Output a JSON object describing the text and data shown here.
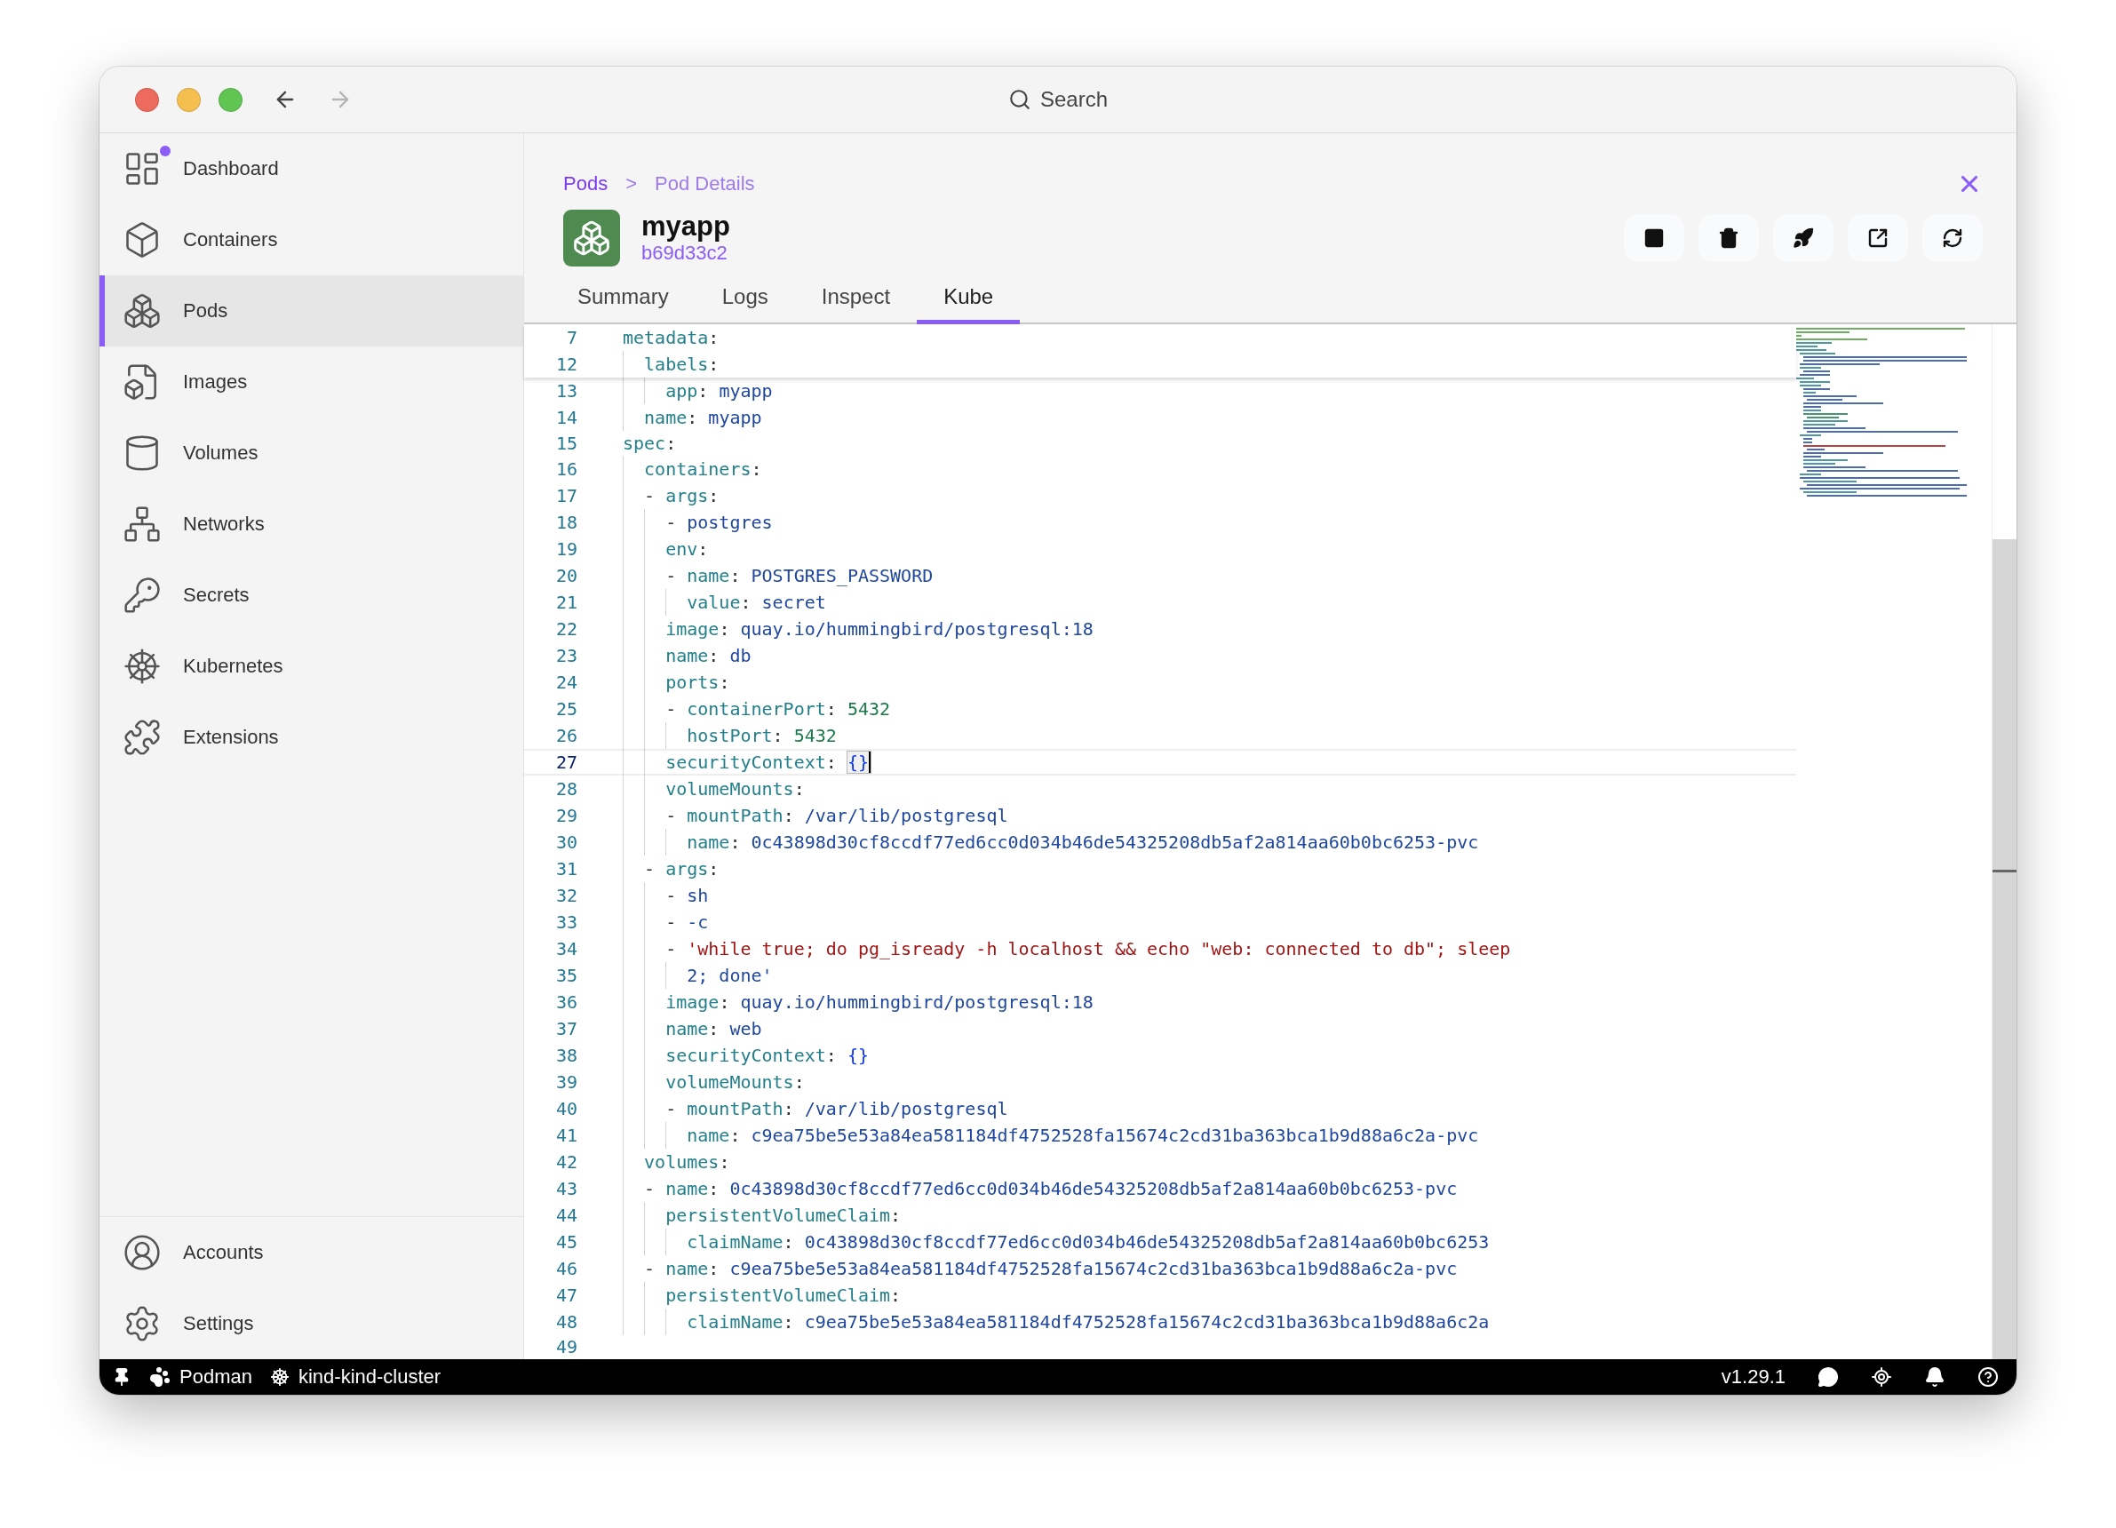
{
  "title_bar": {
    "search_label": "Search"
  },
  "sidebar": {
    "items": [
      {
        "kind": "dashboard",
        "label": "Dashboard",
        "selected": false,
        "notification": true
      },
      {
        "kind": "containers",
        "label": "Containers",
        "selected": false,
        "notification": false
      },
      {
        "kind": "pods",
        "label": "Pods",
        "selected": true,
        "notification": false
      },
      {
        "kind": "images",
        "label": "Images",
        "selected": false,
        "notification": false
      },
      {
        "kind": "volumes",
        "label": "Volumes",
        "selected": false,
        "notification": false
      },
      {
        "kind": "networks",
        "label": "Networks",
        "selected": false,
        "notification": false
      },
      {
        "kind": "secrets",
        "label": "Secrets",
        "selected": false,
        "notification": false
      },
      {
        "kind": "kubernetes",
        "label": "Kubernetes",
        "selected": false,
        "notification": false
      },
      {
        "kind": "extensions",
        "label": "Extensions",
        "selected": false,
        "notification": false
      }
    ],
    "bottom_items": [
      {
        "kind": "accounts",
        "label": "Accounts",
        "selected": false
      },
      {
        "kind": "settings",
        "label": "Settings",
        "selected": false
      }
    ]
  },
  "breadcrumb": {
    "items": [
      "Pods",
      "Pod Details"
    ],
    "separator": ">"
  },
  "pod": {
    "name": "myapp",
    "id": "b69d33c2"
  },
  "actions": [
    {
      "kind": "stop"
    },
    {
      "kind": "delete"
    },
    {
      "kind": "deploy"
    },
    {
      "kind": "open"
    },
    {
      "kind": "restart"
    }
  ],
  "tabs": [
    {
      "label": "Summary",
      "selected": false
    },
    {
      "label": "Logs",
      "selected": false
    },
    {
      "label": "Inspect",
      "selected": false
    },
    {
      "label": "Kube",
      "selected": true
    }
  ],
  "editor": {
    "sticky_lines": [
      {
        "number": "7",
        "current": false,
        "tokens": [
          {
            "kind": "key",
            "text": "metadata"
          },
          {
            "kind": "punct",
            "text": ":"
          }
        ]
      },
      {
        "number": "12",
        "current": false,
        "tokens": [
          {
            "kind": "key",
            "text": "  labels"
          },
          {
            "kind": "punct",
            "text": ":"
          }
        ]
      }
    ],
    "lines": [
      {
        "number": "13",
        "current": false,
        "tokens": [
          {
            "kind": "key",
            "text": "    app"
          },
          {
            "kind": "punct",
            "text": ": "
          },
          {
            "kind": "value",
            "text": "myapp"
          }
        ]
      },
      {
        "number": "14",
        "current": false,
        "tokens": [
          {
            "kind": "key",
            "text": "  name"
          },
          {
            "kind": "punct",
            "text": ": "
          },
          {
            "kind": "value",
            "text": "myapp"
          }
        ]
      },
      {
        "number": "15",
        "current": false,
        "tokens": [
          {
            "kind": "key",
            "text": "spec"
          },
          {
            "kind": "punct",
            "text": ":"
          }
        ]
      },
      {
        "number": "16",
        "current": false,
        "tokens": [
          {
            "kind": "key",
            "text": "  containers"
          },
          {
            "kind": "punct",
            "text": ":"
          }
        ]
      },
      {
        "number": "17",
        "current": false,
        "tokens": [
          {
            "kind": "punct",
            "text": "  - "
          },
          {
            "kind": "key",
            "text": "args"
          },
          {
            "kind": "punct",
            "text": ":"
          }
        ]
      },
      {
        "number": "18",
        "current": false,
        "tokens": [
          {
            "kind": "punct",
            "text": "    - "
          },
          {
            "kind": "value",
            "text": "postgres"
          }
        ]
      },
      {
        "number": "19",
        "current": false,
        "tokens": [
          {
            "kind": "key",
            "text": "    env"
          },
          {
            "kind": "punct",
            "text": ":"
          }
        ]
      },
      {
        "number": "20",
        "current": false,
        "tokens": [
          {
            "kind": "punct",
            "text": "    - "
          },
          {
            "kind": "key",
            "text": "name"
          },
          {
            "kind": "punct",
            "text": ": "
          },
          {
            "kind": "value",
            "text": "POSTGRES_PASSWORD"
          }
        ]
      },
      {
        "number": "21",
        "current": false,
        "tokens": [
          {
            "kind": "key",
            "text": "      value"
          },
          {
            "kind": "punct",
            "text": ": "
          },
          {
            "kind": "value",
            "text": "secret"
          }
        ]
      },
      {
        "number": "22",
        "current": false,
        "tokens": [
          {
            "kind": "key",
            "text": "    image"
          },
          {
            "kind": "punct",
            "text": ": "
          },
          {
            "kind": "value",
            "text": "quay.io/hummingbird/postgresql:18"
          }
        ]
      },
      {
        "number": "23",
        "current": false,
        "tokens": [
          {
            "kind": "key",
            "text": "    name"
          },
          {
            "kind": "punct",
            "text": ": "
          },
          {
            "kind": "value",
            "text": "db"
          }
        ]
      },
      {
        "number": "24",
        "current": false,
        "tokens": [
          {
            "kind": "key",
            "text": "    ports"
          },
          {
            "kind": "punct",
            "text": ":"
          }
        ]
      },
      {
        "number": "25",
        "current": false,
        "tokens": [
          {
            "kind": "punct",
            "text": "    - "
          },
          {
            "kind": "key",
            "text": "containerPort"
          },
          {
            "kind": "punct",
            "text": ": "
          },
          {
            "kind": "number",
            "text": "5432"
          }
        ]
      },
      {
        "number": "26",
        "current": false,
        "tokens": [
          {
            "kind": "key",
            "text": "      hostPort"
          },
          {
            "kind": "punct",
            "text": ": "
          },
          {
            "kind": "number",
            "text": "5432"
          }
        ]
      },
      {
        "number": "27",
        "current": true,
        "tokens": [
          {
            "kind": "key",
            "text": "    securityContext"
          },
          {
            "kind": "punct",
            "text": ": "
          },
          {
            "kind": "brace",
            "text": "{}"
          }
        ]
      },
      {
        "number": "28",
        "current": false,
        "tokens": [
          {
            "kind": "key",
            "text": "    volumeMounts"
          },
          {
            "kind": "punct",
            "text": ":"
          }
        ]
      },
      {
        "number": "29",
        "current": false,
        "tokens": [
          {
            "kind": "punct",
            "text": "    - "
          },
          {
            "kind": "key",
            "text": "mountPath"
          },
          {
            "kind": "punct",
            "text": ": "
          },
          {
            "kind": "value",
            "text": "/var/lib/postgresql"
          }
        ]
      },
      {
        "number": "30",
        "current": false,
        "tokens": [
          {
            "kind": "key",
            "text": "      name"
          },
          {
            "kind": "punct",
            "text": ": "
          },
          {
            "kind": "value",
            "text": "0c43898d30cf8ccdf77ed6cc0d034b46de54325208db5af2a814aa60b0bc6253-pvc"
          }
        ]
      },
      {
        "number": "31",
        "current": false,
        "tokens": [
          {
            "kind": "punct",
            "text": "  - "
          },
          {
            "kind": "key",
            "text": "args"
          },
          {
            "kind": "punct",
            "text": ":"
          }
        ]
      },
      {
        "number": "32",
        "current": false,
        "tokens": [
          {
            "kind": "punct",
            "text": "    - "
          },
          {
            "kind": "value",
            "text": "sh"
          }
        ]
      },
      {
        "number": "33",
        "current": false,
        "tokens": [
          {
            "kind": "punct",
            "text": "    - "
          },
          {
            "kind": "value",
            "text": "-c"
          }
        ]
      },
      {
        "number": "34",
        "current": false,
        "tokens": [
          {
            "kind": "punct",
            "text": "    - "
          },
          {
            "kind": "string",
            "text": "'while true; do pg_isready -h localhost && echo \"web: connected to db\"; sleep"
          }
        ]
      },
      {
        "number": "35",
        "current": false,
        "tokens": [
          {
            "kind": "value",
            "text": "      2; done'"
          }
        ]
      },
      {
        "number": "36",
        "current": false,
        "tokens": [
          {
            "kind": "key",
            "text": "    image"
          },
          {
            "kind": "punct",
            "text": ": "
          },
          {
            "kind": "value",
            "text": "quay.io/hummingbird/postgresql:18"
          }
        ]
      },
      {
        "number": "37",
        "current": false,
        "tokens": [
          {
            "kind": "key",
            "text": "    name"
          },
          {
            "kind": "punct",
            "text": ": "
          },
          {
            "kind": "value",
            "text": "web"
          }
        ]
      },
      {
        "number": "38",
        "current": false,
        "tokens": [
          {
            "kind": "key",
            "text": "    securityContext"
          },
          {
            "kind": "punct",
            "text": ": "
          },
          {
            "kind": "brace",
            "text": "{}"
          }
        ]
      },
      {
        "number": "39",
        "current": false,
        "tokens": [
          {
            "kind": "key",
            "text": "    volumeMounts"
          },
          {
            "kind": "punct",
            "text": ":"
          }
        ]
      },
      {
        "number": "40",
        "current": false,
        "tokens": [
          {
            "kind": "punct",
            "text": "    - "
          },
          {
            "kind": "key",
            "text": "mountPath"
          },
          {
            "kind": "punct",
            "text": ": "
          },
          {
            "kind": "value",
            "text": "/var/lib/postgresql"
          }
        ]
      },
      {
        "number": "41",
        "current": false,
        "tokens": [
          {
            "kind": "key",
            "text": "      name"
          },
          {
            "kind": "punct",
            "text": ": "
          },
          {
            "kind": "value",
            "text": "c9ea75be5e53a84ea581184df4752528fa15674c2cd31ba363bca1b9d88a6c2a-pvc"
          }
        ]
      },
      {
        "number": "42",
        "current": false,
        "tokens": [
          {
            "kind": "key",
            "text": "  volumes"
          },
          {
            "kind": "punct",
            "text": ":"
          }
        ]
      },
      {
        "number": "43",
        "current": false,
        "tokens": [
          {
            "kind": "punct",
            "text": "  - "
          },
          {
            "kind": "key",
            "text": "name"
          },
          {
            "kind": "punct",
            "text": ": "
          },
          {
            "kind": "value",
            "text": "0c43898d30cf8ccdf77ed6cc0d034b46de54325208db5af2a814aa60b0bc6253-pvc"
          }
        ]
      },
      {
        "number": "44",
        "current": false,
        "tokens": [
          {
            "kind": "key",
            "text": "    persistentVolumeClaim"
          },
          {
            "kind": "punct",
            "text": ":"
          }
        ]
      },
      {
        "number": "45",
        "current": false,
        "tokens": [
          {
            "kind": "key",
            "text": "      claimName"
          },
          {
            "kind": "punct",
            "text": ": "
          },
          {
            "kind": "value",
            "text": "0c43898d30cf8ccdf77ed6cc0d034b46de54325208db5af2a814aa60b0bc6253"
          }
        ]
      },
      {
        "number": "46",
        "current": false,
        "tokens": [
          {
            "kind": "punct",
            "text": "  - "
          },
          {
            "kind": "key",
            "text": "name"
          },
          {
            "kind": "punct",
            "text": ": "
          },
          {
            "kind": "value",
            "text": "c9ea75be5e53a84ea581184df4752528fa15674c2cd31ba363bca1b9d88a6c2a-pvc"
          }
        ]
      },
      {
        "number": "47",
        "current": false,
        "tokens": [
          {
            "kind": "key",
            "text": "    persistentVolumeClaim"
          },
          {
            "kind": "punct",
            "text": ":"
          }
        ]
      },
      {
        "number": "48",
        "current": false,
        "tokens": [
          {
            "kind": "key",
            "text": "      claimName"
          },
          {
            "kind": "punct",
            "text": ": "
          },
          {
            "kind": "value",
            "text": "c9ea75be5e53a84ea581184df4752528fa15674c2cd31ba363bca1b9d88a6c2a"
          }
        ]
      },
      {
        "number": "49",
        "current": false
      }
    ]
  },
  "status_bar": {
    "engine": "Podman",
    "context": "kind-kind-cluster",
    "version": "v1.29.1"
  }
}
